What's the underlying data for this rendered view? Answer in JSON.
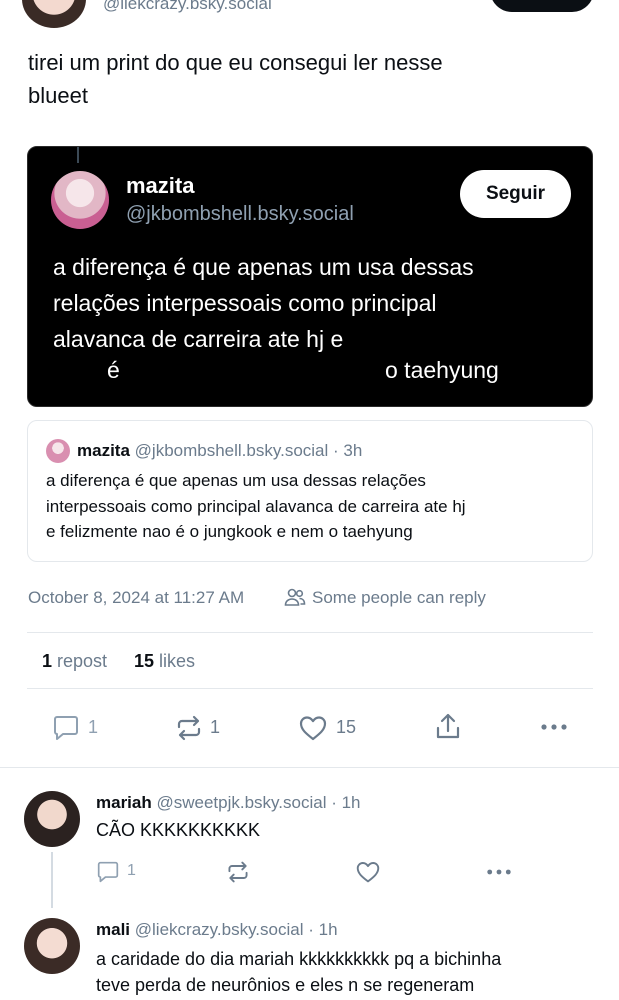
{
  "header": {
    "handle": "@liekcrazy.bsky.social"
  },
  "post": {
    "text_line1": "tirei um print do que eu consegui ler nesse",
    "text_line2": "blueet"
  },
  "screenshot_card": {
    "name": "mazita",
    "handle": "@jkbombshell.bsky.social",
    "follow_label": "Seguir",
    "line1": "a diferença é que apenas um usa dessas",
    "line2": "relações interpessoais como principal",
    "line3": "alavanca de carreira ate hj e",
    "line4a": "é",
    "line4b": "o taehyung"
  },
  "quote": {
    "name": "mazita",
    "handle": "@jkbombshell.bsky.social",
    "time": "· 3h",
    "line1": "a diferença é que apenas um usa dessas relações",
    "line2": "interpessoais como principal alavanca de carreira ate hj",
    "line3": "e felizmente nao é o jungkook e nem o taehyung"
  },
  "meta": {
    "date": "October 8, 2024 at 11:27 AM",
    "reply_setting": "Some people can reply"
  },
  "stats": {
    "reposts_count": "1",
    "reposts_label": "repost",
    "likes_count": "15",
    "likes_label": "likes"
  },
  "actions": {
    "reply_count": "1",
    "repost_count": "1",
    "like_count": "15"
  },
  "replies": [
    {
      "name": "mariah",
      "handle": "@sweetpjk.bsky.social",
      "time": "· 1h",
      "text": "CÃO KKKKKKKKKK",
      "reply_count": "1"
    },
    {
      "name": "mali",
      "handle": "@liekcrazy.bsky.social",
      "time": "· 1h",
      "text_line1": "a caridade do dia mariah kkkkkkkkkk pq a bichinha",
      "text_line2": "teve perda de neurônios e eles n se regeneram"
    }
  ],
  "colors": {
    "accent": "#1083fe",
    "muted": "#6b7b8c",
    "icon_muted": "#8fa0b1",
    "border": "#e4e8ec"
  },
  "icons": [
    "reply-icon",
    "repost-icon",
    "like-icon",
    "share-icon",
    "more-icon",
    "people-icon"
  ]
}
